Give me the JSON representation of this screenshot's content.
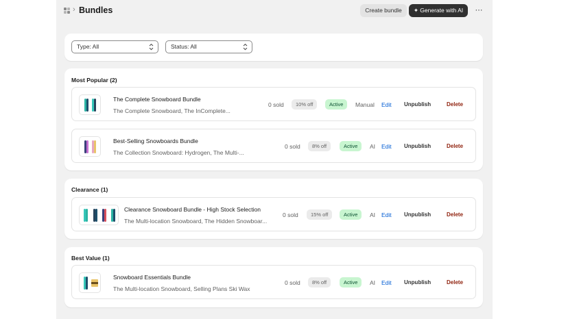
{
  "header": {
    "title": "Bundles",
    "create_label": "Create bundle",
    "generate_label": "✦ Generate with AI",
    "more_label": "⋯"
  },
  "filters": {
    "type": "Type: All",
    "status": "Status: All"
  },
  "groups": [
    {
      "title": "Most Popular (2)",
      "bundles": [
        {
          "name": "The Complete Snowboard Bundle",
          "products": "The Complete Snowboard, The InComplete...",
          "sold": "0 sold",
          "discount": "10% off",
          "status": "Active",
          "mode": "Manual",
          "edit": "Edit",
          "unpublish": "Unpublish",
          "delete": "Delete"
        },
        {
          "name": "Best-Selling Snowboards Bundle",
          "products": "The Collection Snowboard: Hydrogen, The Multi-...",
          "sold": "0 sold",
          "discount": "8% off",
          "status": "Active",
          "mode": "AI",
          "edit": "Edit",
          "unpublish": "Unpublish",
          "delete": "Delete"
        }
      ]
    },
    {
      "title": "Clearance (1)",
      "bundles": [
        {
          "name": "Clearance Snowboard Bundle - High Stock Selection",
          "products": "The Multi-location Snowboard, The Hidden Snowboar...",
          "sold": "0 sold",
          "discount": "15% off",
          "status": "Active",
          "mode": "AI",
          "edit": "Edit",
          "unpublish": "Unpublish",
          "delete": "Delete"
        }
      ]
    },
    {
      "title": "Best Value (1)",
      "bundles": [
        {
          "name": "Snowboard Essentials Bundle",
          "products": "The Multi-location Snowboard, Selling Plans Ski Wax",
          "sold": "0 sold",
          "discount": "8% off",
          "status": "Active",
          "mode": "AI",
          "edit": "Edit",
          "unpublish": "Unpublish",
          "delete": "Delete"
        }
      ]
    }
  ],
  "colors": {
    "page_bg": "#f1f1f1",
    "primary_button": "#303030",
    "active_badge": "#c8f5d0",
    "link": "#005bd3",
    "delete": "#8e1f0b"
  }
}
